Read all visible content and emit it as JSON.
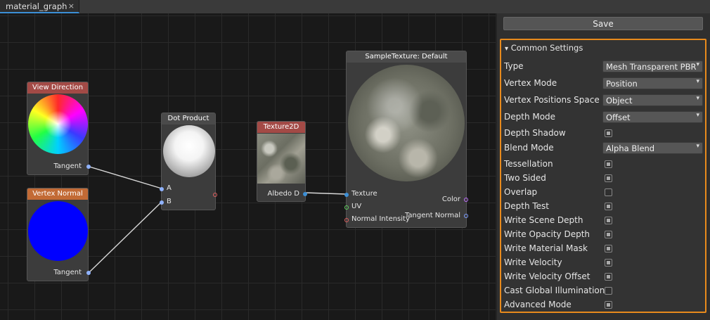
{
  "tab": {
    "title": "material_graph",
    "close": "×"
  },
  "nodes": {
    "view_direction": {
      "title": "View Direction",
      "out": "Tangent"
    },
    "vertex_normal": {
      "title": "Vertex Normal",
      "out": "Tangent"
    },
    "dot_product": {
      "title": "Dot Product",
      "in_a": "A",
      "in_b": "B"
    },
    "texture2d": {
      "title": "Texture2D",
      "out": "Albedo D"
    },
    "sample_texture": {
      "title": "SampleTexture: Default",
      "in_texture": "Texture",
      "in_uv": "UV",
      "in_normal_intensity": "Normal Intensity",
      "out_color": "Color",
      "out_tangent_normal": "Tangent Normal"
    }
  },
  "panel": {
    "save_label": "Save",
    "section_title": "Common Settings",
    "section_arrow": "▾",
    "dropdown_arrow": "▾",
    "settings": [
      {
        "label": "Type",
        "kind": "dropdown",
        "value": "Mesh Transparent PBR"
      },
      {
        "label": "Vertex Mode",
        "kind": "dropdown",
        "value": "Position"
      },
      {
        "label": "Vertex Positions Space",
        "kind": "dropdown",
        "value": "Object"
      },
      {
        "label": "Depth Mode",
        "kind": "dropdown",
        "value": "Offset"
      },
      {
        "label": "Depth Shadow",
        "kind": "checkbox",
        "checked": true
      },
      {
        "label": "Blend Mode",
        "kind": "dropdown",
        "value": "Alpha Blend"
      },
      {
        "label": "Tessellation",
        "kind": "checkbox",
        "checked": true
      },
      {
        "label": "Two Sided",
        "kind": "checkbox",
        "checked": true
      },
      {
        "label": "Overlap",
        "kind": "checkbox",
        "checked": false
      },
      {
        "label": "Depth Test",
        "kind": "checkbox",
        "checked": true
      },
      {
        "label": "Write Scene Depth",
        "kind": "checkbox",
        "checked": true
      },
      {
        "label": "Write Opacity Depth",
        "kind": "checkbox",
        "checked": true
      },
      {
        "label": "Write Material Mask",
        "kind": "checkbox",
        "checked": true
      },
      {
        "label": "Write Velocity",
        "kind": "checkbox",
        "checked": true
      },
      {
        "label": "Write Velocity Offset",
        "kind": "checkbox",
        "checked": true
      },
      {
        "label": "Cast Global Illumination",
        "kind": "checkbox",
        "checked": false
      },
      {
        "label": "Advanced Mode",
        "kind": "checkbox",
        "checked": true
      }
    ]
  },
  "colors": {
    "header_red": "#a34a46",
    "header_orange": "#c26a35",
    "header_gray": "#4a4a4a",
    "accent_orange": "#e88a1c",
    "tab_accent": "#3c8fd6"
  }
}
